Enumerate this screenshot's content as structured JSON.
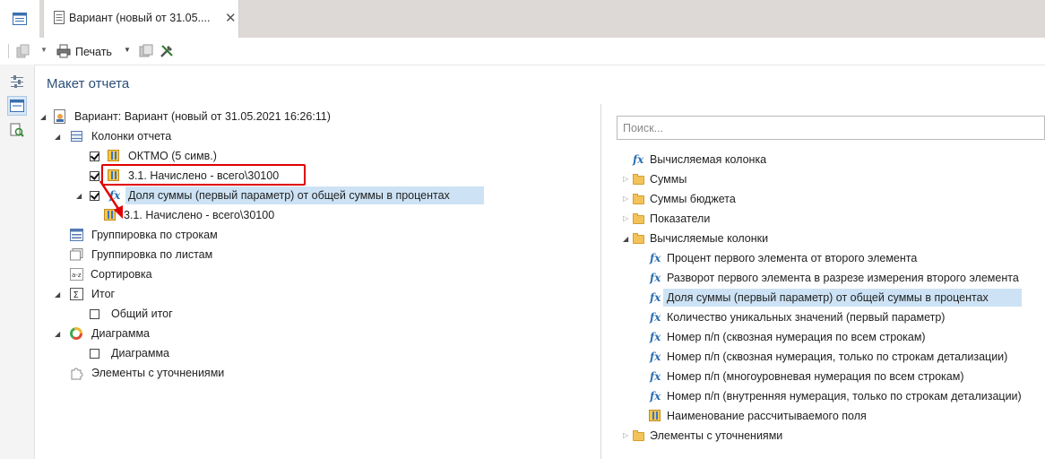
{
  "tab": {
    "title": "Вариант (новый от 31.05....",
    "close": "✕"
  },
  "toolbar": {
    "print_label": "Печать"
  },
  "section_title": "Макет отчета",
  "left_tree": {
    "root": "Вариант: Вариант (новый от 31.05.2021 16:26:11)",
    "columns_group": "Колонки отчета",
    "col1": "ОКТМО (5 симв.)",
    "col2": "3.1. Начислено - всего\\30100",
    "col3": "Доля суммы (первый параметр) от общей суммы в процентах",
    "col3_child": "3.1. Начислено - всего\\30100",
    "group_rows": "Группировка по строкам",
    "group_sheets": "Группировка по листам",
    "sort": "Сортировка",
    "total": "Итог",
    "total_child": "Общий итог",
    "chart": "Диаграмма",
    "chart_child": "Диаграмма",
    "refinements": "Элементы с уточнениями"
  },
  "search": {
    "placeholder": "Поиск..."
  },
  "right_tree": {
    "calc_column": "Вычисляемая колонка",
    "sums": "Суммы",
    "budget_sums": "Суммы бюджета",
    "indicators": "Показатели",
    "calc_columns": "Вычисляемые колонки",
    "items": [
      "Процент первого элемента от второго элемента",
      "Разворот первого элемента в разрезе измерения второго элемента",
      "Доля суммы (первый параметр) от общей суммы в процентах",
      "Количество уникальных значений (первый параметр)",
      "Номер п/п (сквозная нумерация по всем строкам)",
      "Номер п/п (сквозная нумерация, только по строкам детализации)",
      "Номер п/п (многоуровневая нумерация по всем строкам)",
      "Номер п/п (внутренняя нумерация, только по строкам детализации)"
    ],
    "calc_field_name": "Наименование рассчитываемого поля",
    "refinements": "Элементы с уточнениями"
  },
  "colors": {
    "highlight": "#cde3f5",
    "annotation": "#e00000",
    "title": "#2b4f7a"
  }
}
